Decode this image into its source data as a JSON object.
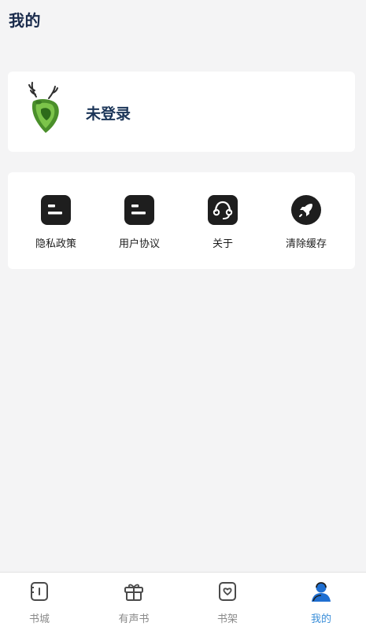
{
  "header": {
    "title": "我的"
  },
  "profile": {
    "status": "未登录",
    "avatar_icon": "deer-logo-icon"
  },
  "menu": {
    "items": [
      {
        "label": "隐私政策",
        "icon": "document-icon"
      },
      {
        "label": "用户协议",
        "icon": "document-icon"
      },
      {
        "label": "关于",
        "icon": "headset-icon"
      },
      {
        "label": "清除缓存",
        "icon": "rocket-icon"
      }
    ]
  },
  "tabbar": {
    "items": [
      {
        "label": "书城",
        "icon": "bookstore-icon",
        "active": false
      },
      {
        "label": "有声书",
        "icon": "gift-icon",
        "active": false
      },
      {
        "label": "书架",
        "icon": "bookshelf-icon",
        "active": false
      },
      {
        "label": "我的",
        "icon": "user-icon",
        "active": true
      }
    ]
  },
  "colors": {
    "accent": "#3c8fd9",
    "title": "#1a2b4c",
    "background": "#f4f4f5",
    "inactive_tab": "#8a8a8a"
  }
}
